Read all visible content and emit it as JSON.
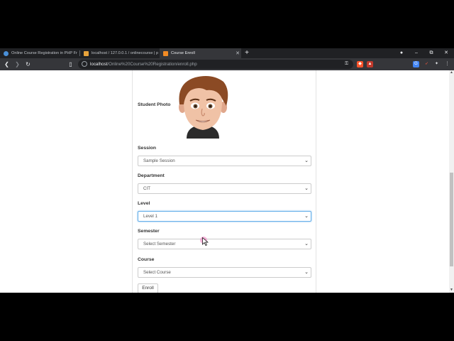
{
  "browser": {
    "tabs": [
      {
        "title": "Online Course Registration in PHP Fr",
        "active": false
      },
      {
        "title": "localhost / 127.0.0.1 / onlinecourse | p",
        "active": false
      },
      {
        "title": "Course Enroll",
        "active": true
      }
    ],
    "new_tab_label": "+",
    "url_host": "localhost",
    "url_path": "/Online%20Course%20Registration/enroll.php",
    "window_controls": {
      "minimize": "–",
      "restore": "⧉",
      "close": "✕"
    }
  },
  "form": {
    "photo_label": "Student Photo",
    "fields": [
      {
        "label": "Session",
        "value": "Sample Session"
      },
      {
        "label": "Department",
        "value": "CIT"
      },
      {
        "label": "Level",
        "value": "Level 1"
      },
      {
        "label": "Semester",
        "value": "Select Semester"
      },
      {
        "label": "Course",
        "value": "Select Course"
      }
    ],
    "enroll_label": "Enroll"
  },
  "colors": {
    "focus_border": "#66afe9",
    "chrome_dark": "#202124",
    "chrome_toolbar": "#35363a"
  }
}
